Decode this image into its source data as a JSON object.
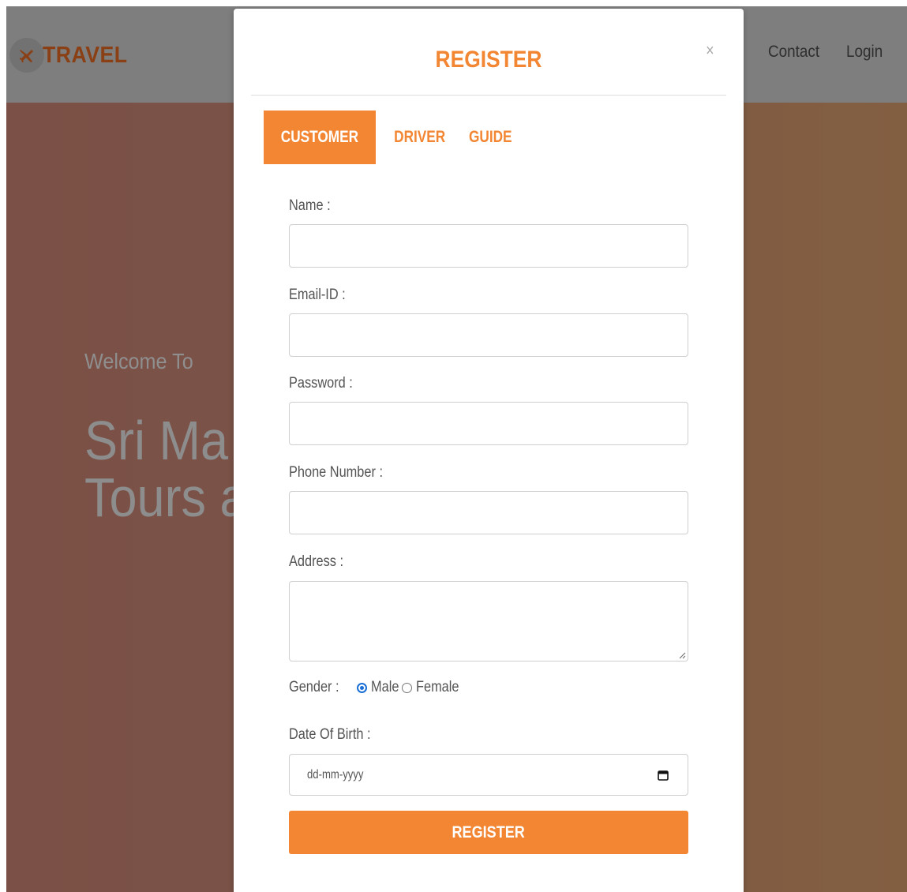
{
  "topbar": {
    "logo_text": "TRAVEL",
    "nav": [
      {
        "label": "Contact"
      },
      {
        "label": "Login"
      }
    ]
  },
  "hero": {
    "welcome": "Welcome To",
    "title_line1": "Sri Ma",
    "title_line2": "Tours a"
  },
  "modal": {
    "title": "REGISTER",
    "close_glyph": "×",
    "tabs": [
      {
        "label": "CUSTOMER",
        "active": true
      },
      {
        "label": "DRIVER",
        "active": false
      },
      {
        "label": "GUIDE",
        "active": false
      }
    ],
    "form": {
      "name_label": "Name :",
      "name_value": "",
      "email_label": "Email-ID :",
      "email_value": "",
      "password_label": "Password :",
      "password_value": "",
      "phone_label": "Phone Number :",
      "phone_value": "",
      "address_label": "Address :",
      "address_value": "",
      "gender_label": "Gender :",
      "gender_options": [
        {
          "label": "Male",
          "checked": true
        },
        {
          "label": "Female",
          "checked": false
        }
      ],
      "dob_label": "Date Of Birth :",
      "dob_placeholder": "dd-mm-yyyy",
      "submit_label": "REGISTER"
    }
  },
  "colors": {
    "accent": "#f28633",
    "logo": "#8a3f14",
    "radio_checked": "#1a6fd6"
  },
  "icons": {
    "logo": "plane-icon",
    "close": "close-icon",
    "calendar": "calendar-icon"
  }
}
